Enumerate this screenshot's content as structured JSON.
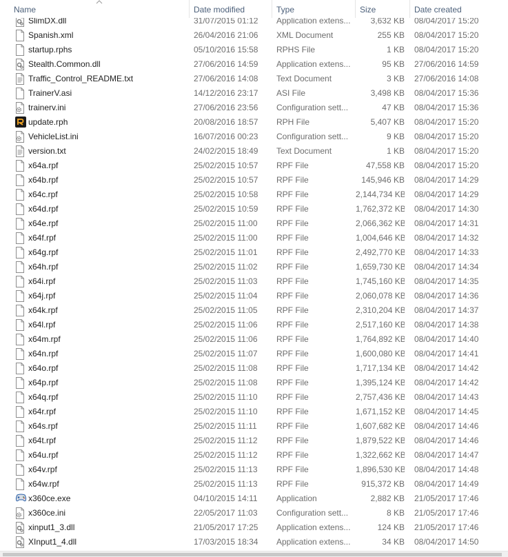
{
  "columns": {
    "name": "Name",
    "date_modified": "Date modified",
    "type": "Type",
    "size": "Size",
    "date_created": "Date created"
  },
  "colors": {
    "header_text": "#4c607a",
    "cell_secondary": "#6d6d6d",
    "rph_icon_bg": "#1a1a1a",
    "rph_icon_fg": "#f5a623",
    "app_icon": "#2a5fa8"
  },
  "files": [
    {
      "name": "SlimDX.dll",
      "modified": "31/07/2015 01:12",
      "type": "Application extens...",
      "size": "3,632 KB",
      "created": "08/04/2017 15:20",
      "icon": "dll-icon"
    },
    {
      "name": "Spanish.xml",
      "modified": "26/04/2016 21:06",
      "type": "XML Document",
      "size": "255 KB",
      "created": "08/04/2017 15:20",
      "icon": "file-icon"
    },
    {
      "name": "startup.rphs",
      "modified": "05/10/2016 15:58",
      "type": "RPHS File",
      "size": "1 KB",
      "created": "08/04/2017 15:20",
      "icon": "file-icon"
    },
    {
      "name": "Stealth.Common.dll",
      "modified": "27/06/2016 14:59",
      "type": "Application extens...",
      "size": "95 KB",
      "created": "27/06/2016 14:59",
      "icon": "dll-icon"
    },
    {
      "name": "Traffic_Control_README.txt",
      "modified": "27/06/2016 14:08",
      "type": "Text Document",
      "size": "3 KB",
      "created": "27/06/2016 14:08",
      "icon": "text-file-icon"
    },
    {
      "name": "TrainerV.asi",
      "modified": "14/12/2016 23:17",
      "type": "ASI File",
      "size": "3,498 KB",
      "created": "08/04/2017 15:36",
      "icon": "file-icon"
    },
    {
      "name": "trainerv.ini",
      "modified": "27/06/2016 23:56",
      "type": "Configuration sett...",
      "size": "47 KB",
      "created": "08/04/2017 15:36",
      "icon": "config-file-icon"
    },
    {
      "name": "update.rph",
      "modified": "20/08/2016 18:57",
      "type": "RPH File",
      "size": "5,407 KB",
      "created": "08/04/2017 15:20",
      "icon": "rph-app-icon"
    },
    {
      "name": "VehicleList.ini",
      "modified": "16/07/2016 00:23",
      "type": "Configuration sett...",
      "size": "9 KB",
      "created": "08/04/2017 15:20",
      "icon": "config-file-icon"
    },
    {
      "name": "version.txt",
      "modified": "24/02/2015 18:49",
      "type": "Text Document",
      "size": "1 KB",
      "created": "08/04/2017 15:20",
      "icon": "text-file-icon"
    },
    {
      "name": "x64a.rpf",
      "modified": "25/02/2015 10:57",
      "type": "RPF File",
      "size": "47,558 KB",
      "created": "08/04/2017 15:20",
      "icon": "file-icon"
    },
    {
      "name": "x64b.rpf",
      "modified": "25/02/2015 10:57",
      "type": "RPF File",
      "size": "145,946 KB",
      "created": "08/04/2017 14:29",
      "icon": "file-icon"
    },
    {
      "name": "x64c.rpf",
      "modified": "25/02/2015 10:58",
      "type": "RPF File",
      "size": "2,144,734 KB",
      "created": "08/04/2017 14:29",
      "icon": "file-icon"
    },
    {
      "name": "x64d.rpf",
      "modified": "25/02/2015 10:59",
      "type": "RPF File",
      "size": "1,762,372 KB",
      "created": "08/04/2017 14:30",
      "icon": "file-icon"
    },
    {
      "name": "x64e.rpf",
      "modified": "25/02/2015 11:00",
      "type": "RPF File",
      "size": "2,066,362 KB",
      "created": "08/04/2017 14:31",
      "icon": "file-icon"
    },
    {
      "name": "x64f.rpf",
      "modified": "25/02/2015 11:00",
      "type": "RPF File",
      "size": "1,004,646 KB",
      "created": "08/04/2017 14:32",
      "icon": "file-icon"
    },
    {
      "name": "x64g.rpf",
      "modified": "25/02/2015 11:01",
      "type": "RPF File",
      "size": "2,492,770 KB",
      "created": "08/04/2017 14:33",
      "icon": "file-icon"
    },
    {
      "name": "x64h.rpf",
      "modified": "25/02/2015 11:02",
      "type": "RPF File",
      "size": "1,659,730 KB",
      "created": "08/04/2017 14:34",
      "icon": "file-icon"
    },
    {
      "name": "x64i.rpf",
      "modified": "25/02/2015 11:03",
      "type": "RPF File",
      "size": "1,745,160 KB",
      "created": "08/04/2017 14:35",
      "icon": "file-icon"
    },
    {
      "name": "x64j.rpf",
      "modified": "25/02/2015 11:04",
      "type": "RPF File",
      "size": "2,060,078 KB",
      "created": "08/04/2017 14:36",
      "icon": "file-icon"
    },
    {
      "name": "x64k.rpf",
      "modified": "25/02/2015 11:05",
      "type": "RPF File",
      "size": "2,310,204 KB",
      "created": "08/04/2017 14:37",
      "icon": "file-icon"
    },
    {
      "name": "x64l.rpf",
      "modified": "25/02/2015 11:06",
      "type": "RPF File",
      "size": "2,517,160 KB",
      "created": "08/04/2017 14:38",
      "icon": "file-icon"
    },
    {
      "name": "x64m.rpf",
      "modified": "25/02/2015 11:06",
      "type": "RPF File",
      "size": "1,764,892 KB",
      "created": "08/04/2017 14:40",
      "icon": "file-icon"
    },
    {
      "name": "x64n.rpf",
      "modified": "25/02/2015 11:07",
      "type": "RPF File",
      "size": "1,600,080 KB",
      "created": "08/04/2017 14:41",
      "icon": "file-icon"
    },
    {
      "name": "x64o.rpf",
      "modified": "25/02/2015 11:08",
      "type": "RPF File",
      "size": "1,717,134 KB",
      "created": "08/04/2017 14:42",
      "icon": "file-icon"
    },
    {
      "name": "x64p.rpf",
      "modified": "25/02/2015 11:08",
      "type": "RPF File",
      "size": "1,395,124 KB",
      "created": "08/04/2017 14:42",
      "icon": "file-icon"
    },
    {
      "name": "x64q.rpf",
      "modified": "25/02/2015 11:10",
      "type": "RPF File",
      "size": "2,757,436 KB",
      "created": "08/04/2017 14:43",
      "icon": "file-icon"
    },
    {
      "name": "x64r.rpf",
      "modified": "25/02/2015 11:10",
      "type": "RPF File",
      "size": "1,671,152 KB",
      "created": "08/04/2017 14:45",
      "icon": "file-icon"
    },
    {
      "name": "x64s.rpf",
      "modified": "25/02/2015 11:11",
      "type": "RPF File",
      "size": "1,607,682 KB",
      "created": "08/04/2017 14:46",
      "icon": "file-icon"
    },
    {
      "name": "x64t.rpf",
      "modified": "25/02/2015 11:12",
      "type": "RPF File",
      "size": "1,879,522 KB",
      "created": "08/04/2017 14:46",
      "icon": "file-icon"
    },
    {
      "name": "x64u.rpf",
      "modified": "25/02/2015 11:12",
      "type": "RPF File",
      "size": "1,322,662 KB",
      "created": "08/04/2017 14:47",
      "icon": "file-icon"
    },
    {
      "name": "x64v.rpf",
      "modified": "25/02/2015 11:13",
      "type": "RPF File",
      "size": "1,896,530 KB",
      "created": "08/04/2017 14:48",
      "icon": "file-icon"
    },
    {
      "name": "x64w.rpf",
      "modified": "25/02/2015 11:13",
      "type": "RPF File",
      "size": "915,372 KB",
      "created": "08/04/2017 14:49",
      "icon": "file-icon"
    },
    {
      "name": "x360ce.exe",
      "modified": "04/10/2015 14:11",
      "type": "Application",
      "size": "2,882 KB",
      "created": "21/05/2017 17:46",
      "icon": "gamepad-app-icon"
    },
    {
      "name": "x360ce.ini",
      "modified": "22/05/2017 11:03",
      "type": "Configuration sett...",
      "size": "8 KB",
      "created": "21/05/2017 17:46",
      "icon": "config-file-icon"
    },
    {
      "name": "xinput1_3.dll",
      "modified": "21/05/2017 17:25",
      "type": "Application extens...",
      "size": "124 KB",
      "created": "21/05/2017 17:46",
      "icon": "dll-icon"
    },
    {
      "name": "XInput1_4.dll",
      "modified": "17/03/2015 18:34",
      "type": "Application extens...",
      "size": "34 KB",
      "created": "08/04/2017 14:50",
      "icon": "dll-icon"
    }
  ]
}
